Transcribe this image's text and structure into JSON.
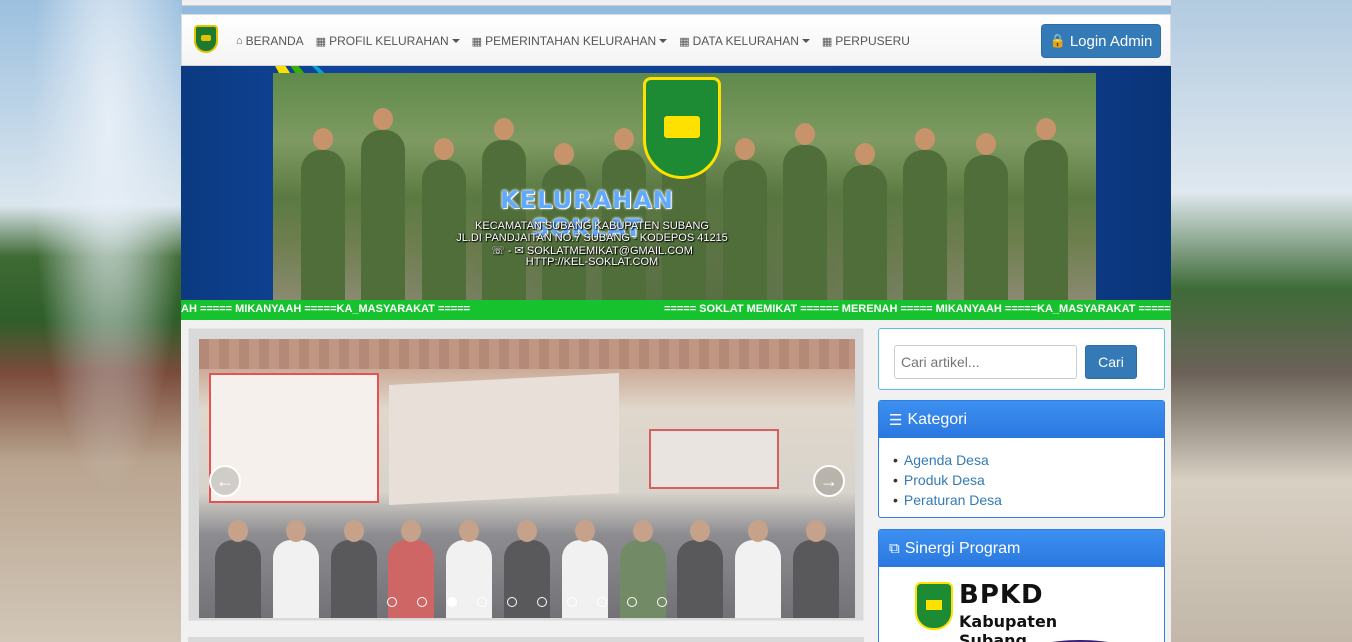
{
  "navbar": {
    "items": [
      {
        "label": "BERANDA",
        "icon": "home-icon",
        "dropdown": false
      },
      {
        "label": "PROFIL KELURAHAN",
        "icon": "grid-icon",
        "dropdown": true
      },
      {
        "label": "PEMERINTAHAN KELURAHAN",
        "icon": "grid-icon",
        "dropdown": true
      },
      {
        "label": "DATA KELURAHAN",
        "icon": "grid-icon",
        "dropdown": true
      },
      {
        "label": "PERPUSERU",
        "icon": "grid-icon",
        "dropdown": false
      }
    ],
    "login_label": "Login Admin"
  },
  "header": {
    "title": "KELURAHAN SOKLAT",
    "line1": "KECAMATAN SUBANG KABUPATEN SUBANG",
    "line2": "JL.DI PANDJAITAN NO.7 SUBANG - KODEPOS 41215",
    "line3": "☏ - ✉ SOKLATMEMIKAT@GMAIL.COM",
    "line4": "HTTP://KEL-SOKLAT.COM"
  },
  "marquee": {
    "text_left": "AH ===== MIKANYAAH =====KA_MASYARAKAT =====",
    "text_right": "===== SOKLAT MEMIKAT ====== MERENAH ===== MIKANYAAH =====KA_MASYARAKAT ====="
  },
  "carousel": {
    "slide_count": 10,
    "active_index": 2,
    "prev_icon": "arrow-left-circle-icon",
    "next_icon": "arrow-right-circle-icon"
  },
  "search": {
    "placeholder": "Cari artikel...",
    "button_label": "Cari"
  },
  "kategori": {
    "title": "Kategori",
    "icon": "list-icon",
    "items": [
      "Agenda Desa",
      "Produk Desa",
      "Peraturan Desa"
    ]
  },
  "sinergi": {
    "title": "Sinergi Program",
    "icon": "external-link-icon",
    "logo_title": "BPKD",
    "logo_subtitle": "Kabupaten Subang"
  },
  "colors": {
    "primary": "#337ab7",
    "panel_head": "#2a78e0",
    "marquee_bg": "#17c22f",
    "header_bg": "#10449a"
  }
}
